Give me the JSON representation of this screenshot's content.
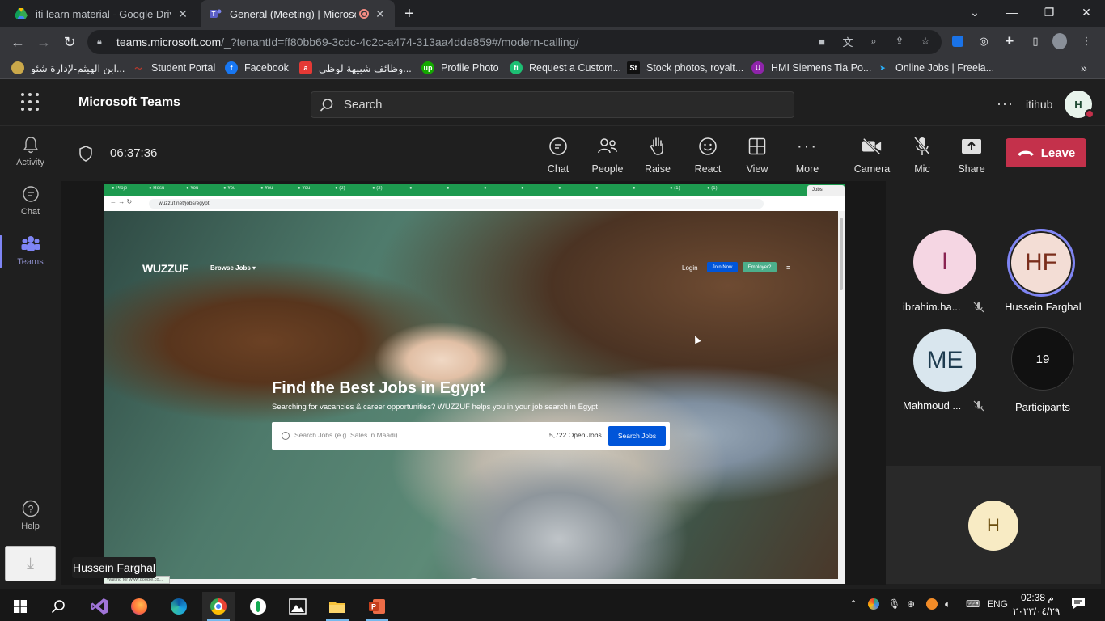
{
  "browser": {
    "tabs": [
      {
        "title": "iti learn material - Google Drive",
        "active": false
      },
      {
        "title": "General (Meeting) | Microsof",
        "active": true
      }
    ],
    "address": {
      "url_host": "teams.microsoft.com",
      "url_path": "/_?tenantId=ff80bb69-3cdc-4c2c-a474-313aa4dde859#/modern-calling/"
    },
    "bookmarks": [
      {
        "label": "ابن الهيثم-لإدارة شئو...",
        "color": "#caa84a"
      },
      {
        "label": "Student Portal",
        "color": "#c0392b"
      },
      {
        "label": "Facebook",
        "color": "#1877f2"
      },
      {
        "label": "وظائف شبيهة لوظي...",
        "color": "#e53935"
      },
      {
        "label": "Profile Photo",
        "color": "#14a800"
      },
      {
        "label": "Request a Custom...",
        "color": "#1dbf73"
      },
      {
        "label": "Stock photos, royalt...",
        "color": "#111111"
      },
      {
        "label": "HMI Siemens Tia Po...",
        "color": "#8e24aa"
      },
      {
        "label": "Online Jobs | Freela...",
        "color": "#29b2fe"
      }
    ]
  },
  "teams": {
    "app_title": "Microsoft Teams",
    "search_placeholder": "Search",
    "org_name": "itihub",
    "me_initial": "H",
    "rail": [
      {
        "label": "Activity",
        "icon": "bell-icon"
      },
      {
        "label": "Chat",
        "icon": "chat-icon"
      },
      {
        "label": "Teams",
        "icon": "teams-icon",
        "active": true
      },
      {
        "label": "Help",
        "icon": "help-icon"
      }
    ],
    "meeting": {
      "timer": "06:37:36",
      "controls": [
        "Chat",
        "People",
        "Raise",
        "React",
        "View",
        "More",
        "Camera",
        "Mic",
        "Share"
      ],
      "leave_label": "Leave",
      "presenter": "Hussein Farghal"
    },
    "participants": [
      {
        "initials": "I",
        "name": "ibrahim.ha...",
        "muted": true,
        "color": "#f5d6e3",
        "text_color": "#8a2352"
      },
      {
        "initials": "HF",
        "name": "Hussein Farghal",
        "muted": false,
        "speaking": true,
        "color": "#f3ddd5",
        "text_color": "#7a2d1b"
      },
      {
        "initials": "ME",
        "name": "Mahmoud ...",
        "muted": true,
        "color": "#d9e6ee",
        "text_color": "#1d3b4f"
      },
      {
        "initials": "19",
        "name": "Participants",
        "muted": false,
        "color": "#111111",
        "text_color": "#ffffff"
      }
    ],
    "self_initial": "H"
  },
  "shared_screen": {
    "url": "wuzzuf.net/jobs/egypt",
    "tab_label": "Jobs",
    "logo": "WUZZUF",
    "browse": "Browse Jobs",
    "login": "Login",
    "join": "Join Now",
    "employer": "Employer?",
    "hero_title": "Find the Best Jobs in Egypt",
    "hero_sub": "Searching for vacancies & career opportunities? WUZZUF helps you in your job search in Egypt",
    "search_placeholder": "Search Jobs (e.g. Sales in Maadi)",
    "open_jobs": "5,722 Open Jobs",
    "search_button": "Search Jobs",
    "status_text": "Waiting for www.google.co..."
  },
  "taskbar": {
    "lang": "ENG",
    "time": "02:38 م",
    "date": "٢٠٢٣/٠٤/٢٩"
  }
}
